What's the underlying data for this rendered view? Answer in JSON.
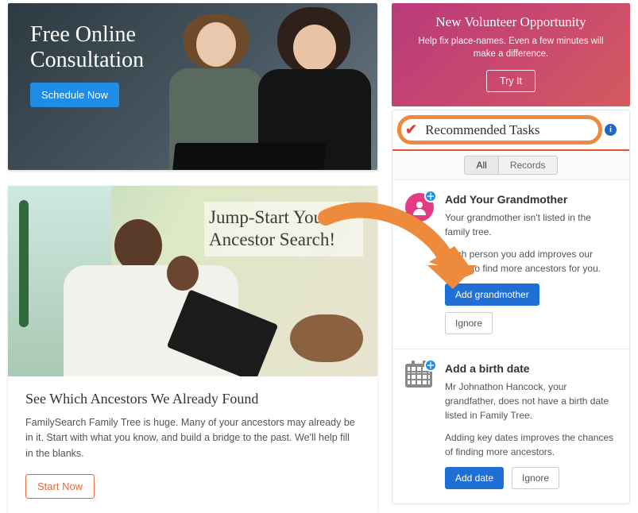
{
  "consult": {
    "title": "Free Online Consultation",
    "cta": "Schedule Now"
  },
  "jumpstart": {
    "overlay": "Jump-Start Your Ancestor Search!",
    "heading": "See Which Ancestors We Already Found",
    "desc": "FamilySearch Family Tree is huge. Many of your ancestors may already be in it. Start with what you know, and build a bridge to the past. We'll help fill in the blanks.",
    "cta": "Start Now"
  },
  "volunteer": {
    "title": "New Volunteer Opportunity",
    "subtitle": "Help fix place-names. Even a few minutes will make a difference.",
    "cta": "Try It"
  },
  "tasks": {
    "header": "Recommended Tasks",
    "tabs": {
      "all": "All",
      "records": "Records"
    },
    "items": [
      {
        "title": "Add Your Grandmother",
        "line1": "Your grandmother isn't listed in the family tree.",
        "line2": "Each person you add improves our ability to find more ancestors for you.",
        "primary": "Add grandmother",
        "secondary": "Ignore"
      },
      {
        "title": "Add a birth date",
        "line1": "Mr Johnathon Hancock, your grandfather, does not have a birth date listed in Family Tree.",
        "line2": "Adding key dates improves the chances of finding more ancestors.",
        "primary": "Add date",
        "secondary": "Ignore"
      }
    ]
  }
}
